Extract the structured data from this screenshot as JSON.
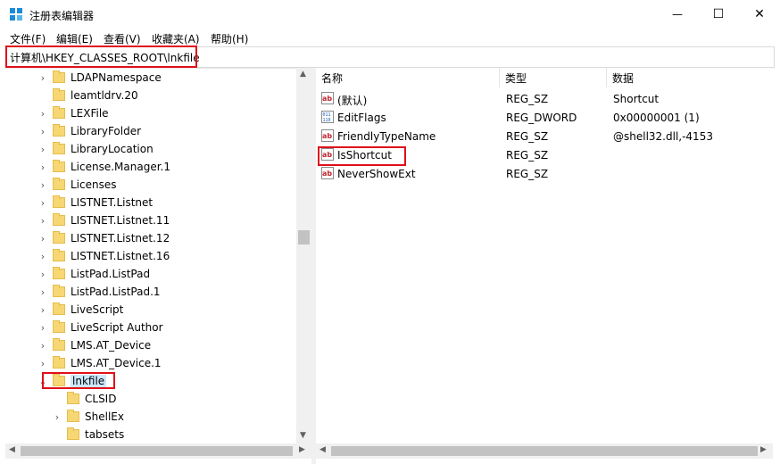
{
  "window": {
    "title": "注册表编辑器",
    "min_symbol": "—",
    "max_symbol": "☐",
    "close_symbol": "✕"
  },
  "menu": [
    "文件(F)",
    "编辑(E)",
    "查看(V)",
    "收藏夹(A)",
    "帮助(H)"
  ],
  "address": "计算机\\HKEY_CLASSES_ROOT\\lnkfile",
  "tree": {
    "items": [
      {
        "label": "LDAPNamespace",
        "expander": "›"
      },
      {
        "label": "leamtldrv.20",
        "expander": ""
      },
      {
        "label": "LEXFile",
        "expander": "›"
      },
      {
        "label": "LibraryFolder",
        "expander": "›"
      },
      {
        "label": "LibraryLocation",
        "expander": "›"
      },
      {
        "label": "License.Manager.1",
        "expander": "›"
      },
      {
        "label": "Licenses",
        "expander": "›"
      },
      {
        "label": "LISTNET.Listnet",
        "expander": "›"
      },
      {
        "label": "LISTNET.Listnet.11",
        "expander": "›"
      },
      {
        "label": "LISTNET.Listnet.12",
        "expander": "›"
      },
      {
        "label": "LISTNET.Listnet.16",
        "expander": "›"
      },
      {
        "label": "ListPad.ListPad",
        "expander": "›"
      },
      {
        "label": "ListPad.ListPad.1",
        "expander": "›"
      },
      {
        "label": "LiveScript",
        "expander": "›"
      },
      {
        "label": "LiveScript Author",
        "expander": "›"
      },
      {
        "label": "LMS.AT_Device",
        "expander": "›"
      },
      {
        "label": "LMS.AT_Device.1",
        "expander": "›"
      },
      {
        "label": "lnkfile",
        "expander": "⌄",
        "selected": true
      },
      {
        "label": "CLSID",
        "expander": "",
        "child": true
      },
      {
        "label": "ShellEx",
        "expander": "›",
        "child": true
      },
      {
        "label": "tabsets",
        "expander": "",
        "child": true
      }
    ]
  },
  "columns": {
    "name": "名称",
    "type": "类型",
    "data": "数据"
  },
  "values": [
    {
      "name": "(默认)",
      "type": "REG_SZ",
      "data": "Shortcut",
      "icon": "string-value-icon"
    },
    {
      "name": "EditFlags",
      "type": "REG_DWORD",
      "data": "0x00000001 (1)",
      "icon": "binary-value-icon"
    },
    {
      "name": "FriendlyTypeName",
      "type": "REG_SZ",
      "data": "@shell32.dll,-4153",
      "icon": "string-value-icon"
    },
    {
      "name": "IsShortcut",
      "type": "REG_SZ",
      "data": "",
      "icon": "string-value-icon"
    },
    {
      "name": "NeverShowExt",
      "type": "REG_SZ",
      "data": "",
      "icon": "string-value-icon"
    }
  ],
  "highlight_color": "#e0101a"
}
